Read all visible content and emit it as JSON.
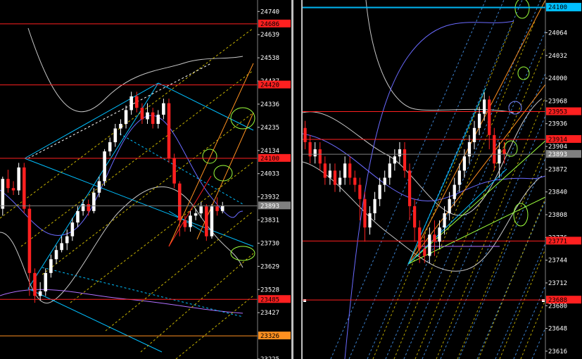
{
  "left_chart": {
    "axis_min": 23225,
    "axis_max": 24790,
    "ticks": [
      24740,
      24639,
      24538,
      24437,
      24336,
      24235,
      24134,
      24033,
      23932,
      23831,
      23730,
      23629,
      23528,
      23427,
      23225
    ],
    "levels": [
      {
        "value": 24686,
        "label": "24686",
        "color": "#ff2020"
      },
      {
        "value": 24420,
        "label": "24420",
        "color": "#ff2020"
      },
      {
        "value": 24100,
        "label": "24100",
        "color": "#ff2020"
      },
      {
        "value": 23485,
        "label": "23485",
        "color": "#ff2020"
      },
      {
        "value": 23326,
        "label": "23326",
        "color": "#ff9020"
      }
    ],
    "current_price": {
      "value": 23893,
      "label": "23893"
    },
    "candles": [
      [
        23880,
        24010,
        23850,
        24020,
        0
      ],
      [
        24010,
        23970,
        23950,
        24050,
        1
      ],
      [
        23970,
        23960,
        23940,
        24000,
        1
      ],
      [
        23960,
        24060,
        23940,
        24080,
        0
      ],
      [
        24060,
        23880,
        23860,
        24080,
        1
      ],
      [
        23880,
        23600,
        23500,
        23900,
        1
      ],
      [
        23600,
        23500,
        23470,
        23620,
        1
      ],
      [
        23500,
        23520,
        23480,
        23560,
        0
      ],
      [
        23520,
        23600,
        23500,
        23620,
        0
      ],
      [
        23600,
        23660,
        23580,
        23680,
        0
      ],
      [
        23660,
        23700,
        23640,
        23720,
        0
      ],
      [
        23700,
        23730,
        23690,
        23760,
        0
      ],
      [
        23730,
        23760,
        23700,
        23790,
        0
      ],
      [
        23760,
        23820,
        23740,
        23840,
        0
      ],
      [
        23820,
        23870,
        23800,
        23890,
        0
      ],
      [
        23870,
        23900,
        23850,
        23920,
        0
      ],
      [
        23900,
        23870,
        23850,
        23920,
        1
      ],
      [
        23870,
        23950,
        23860,
        23970,
        0
      ],
      [
        23950,
        24000,
        23930,
        24020,
        0
      ],
      [
        24000,
        24130,
        23980,
        24140,
        0
      ],
      [
        24130,
        24170,
        24110,
        24190,
        0
      ],
      [
        24170,
        24230,
        24150,
        24250,
        0
      ],
      [
        24230,
        24250,
        24200,
        24270,
        0
      ],
      [
        24250,
        24310,
        24230,
        24330,
        0
      ],
      [
        24310,
        24370,
        24290,
        24390,
        0
      ],
      [
        24370,
        24320,
        24300,
        24390,
        1
      ],
      [
        24320,
        24270,
        24250,
        24340,
        1
      ],
      [
        24270,
        24300,
        24250,
        24340,
        0
      ],
      [
        24300,
        24250,
        24230,
        24320,
        1
      ],
      [
        24250,
        24290,
        24230,
        24310,
        0
      ],
      [
        24290,
        24340,
        24270,
        24360,
        0
      ],
      [
        24340,
        24100,
        24080,
        24360,
        1
      ],
      [
        24100,
        23990,
        23970,
        24120,
        1
      ],
      [
        23990,
        23830,
        23760,
        24000,
        1
      ],
      [
        23830,
        23800,
        23780,
        23850,
        1
      ],
      [
        23800,
        23850,
        23780,
        23870,
        0
      ],
      [
        23850,
        23860,
        23830,
        23880,
        0
      ],
      [
        23860,
        23890,
        23840,
        23910,
        0
      ],
      [
        23890,
        23760,
        23740,
        23900,
        1
      ],
      [
        23760,
        23890,
        23750,
        23900,
        0
      ],
      [
        23890,
        23870,
        23850,
        23930,
        1
      ],
      [
        23870,
        23893,
        23860,
        23910,
        0
      ]
    ]
  },
  "right_chart": {
    "axis_min": 23605,
    "axis_max": 24110,
    "ticks": [
      24064,
      24032,
      24000,
      23968,
      23936,
      23904,
      23872,
      23840,
      23808,
      23776,
      23744,
      23712,
      23680,
      23648,
      23616
    ],
    "levels": [
      {
        "value": 24099,
        "label": "24099",
        "color": "#00bfff"
      },
      {
        "value": 24100,
        "label": "24100",
        "color": "#00bfff"
      },
      {
        "value": 23953,
        "label": "23953",
        "color": "#ff2020"
      },
      {
        "value": 23914,
        "label": "23914",
        "color": "#ff2020"
      },
      {
        "value": 23771,
        "label": "23771",
        "color": "#ff2020"
      },
      {
        "value": 23688,
        "label": "23688",
        "color": "#ff2020"
      }
    ],
    "current_price": {
      "value": 23893,
      "label": "23893"
    },
    "candles": [
      [
        23930,
        23910,
        23900,
        23940,
        1
      ],
      [
        23910,
        23890,
        23880,
        23920,
        1
      ],
      [
        23890,
        23900,
        23880,
        23910,
        0
      ],
      [
        23900,
        23880,
        23870,
        23910,
        1
      ],
      [
        23880,
        23860,
        23850,
        23890,
        1
      ],
      [
        23860,
        23870,
        23850,
        23880,
        0
      ],
      [
        23870,
        23850,
        23840,
        23880,
        1
      ],
      [
        23850,
        23860,
        23840,
        23870,
        0
      ],
      [
        23860,
        23880,
        23850,
        23890,
        0
      ],
      [
        23880,
        23860,
        23850,
        23890,
        1
      ],
      [
        23860,
        23850,
        23840,
        23870,
        1
      ],
      [
        23850,
        23830,
        23800,
        23860,
        1
      ],
      [
        23830,
        23790,
        23770,
        23840,
        1
      ],
      [
        23790,
        23810,
        23780,
        23820,
        0
      ],
      [
        23810,
        23830,
        23800,
        23840,
        0
      ],
      [
        23830,
        23850,
        23820,
        23860,
        0
      ],
      [
        23850,
        23860,
        23840,
        23870,
        0
      ],
      [
        23860,
        23880,
        23850,
        23890,
        0
      ],
      [
        23880,
        23890,
        23870,
        23900,
        0
      ],
      [
        23890,
        23900,
        23880,
        23910,
        0
      ],
      [
        23900,
        23870,
        23860,
        23910,
        1
      ],
      [
        23870,
        23820,
        23800,
        23880,
        1
      ],
      [
        23820,
        23790,
        23770,
        23830,
        1
      ],
      [
        23790,
        23760,
        23740,
        23800,
        1
      ],
      [
        23760,
        23750,
        23740,
        23780,
        1
      ],
      [
        23750,
        23780,
        23740,
        23790,
        0
      ],
      [
        23780,
        23770,
        23750,
        23800,
        1
      ],
      [
        23770,
        23790,
        23760,
        23800,
        0
      ],
      [
        23790,
        23810,
        23780,
        23820,
        0
      ],
      [
        23810,
        23830,
        23800,
        23840,
        0
      ],
      [
        23830,
        23850,
        23820,
        23860,
        0
      ],
      [
        23850,
        23870,
        23840,
        23880,
        0
      ],
      [
        23870,
        23890,
        23860,
        23900,
        0
      ],
      [
        23890,
        23910,
        23880,
        23920,
        0
      ],
      [
        23910,
        23930,
        23900,
        23940,
        0
      ],
      [
        23930,
        23950,
        23920,
        23960,
        0
      ],
      [
        23950,
        23970,
        23940,
        23980,
        0
      ],
      [
        23970,
        23920,
        23900,
        23975,
        1
      ],
      [
        23920,
        23880,
        23870,
        23930,
        1
      ],
      [
        23880,
        23900,
        23860,
        23910,
        0
      ],
      [
        23900,
        23893,
        23880,
        23910,
        1
      ]
    ]
  }
}
